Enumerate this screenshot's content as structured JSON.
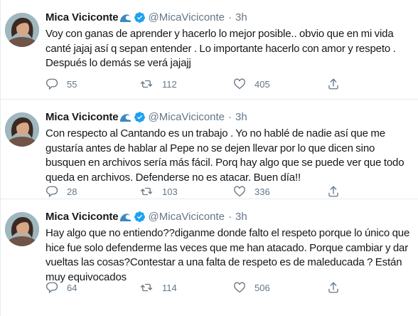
{
  "tweets": [
    {
      "name": "Mica Viciconte",
      "handle": "@MicaViciconte",
      "separator": "·",
      "time": "3h",
      "text": "Voy con ganas de aprender y hacerlo lo mejor posible.. obvio que en mi vida canté jajaj así q sepan entender . Lo importante hacerlo con amor y respeto . Después lo demás se verá jajajj",
      "replies": "55",
      "retweets": "112",
      "likes": "405"
    },
    {
      "name": "Mica Viciconte",
      "handle": "@MicaViciconte",
      "separator": "·",
      "time": "3h",
      "text": "Con respecto al Cantando es un trabajo . Yo no hablé de nadie así que me gustaría antes de hablar al Pepe no se dejen llevar por lo que dicen sino busquen en archivos sería más fácil. Porq hay algo que se puede ver que todo queda en archivos. Defenderse no es atacar. Buen día!!",
      "replies": "28",
      "retweets": "103",
      "likes": "336"
    },
    {
      "name": "Mica Viciconte",
      "handle": "@MicaViciconte",
      "separator": "·",
      "time": "3h",
      "text": "Hay algo que no entiendo??diganme donde falto el respeto porque lo único que hice fue solo defenderme las veces que me han atacado. Porque cambiar y dar vueltas las cosas?Contestar a una falta de respeto es de maleducada ? Están muy equivocados",
      "replies": "64",
      "retweets": "114",
      "likes": "506"
    }
  ],
  "icons": {
    "reply": "reply-icon",
    "retweet": "retweet-icon",
    "like": "like-icon",
    "share": "share-icon",
    "verified": "verified-badge-icon",
    "wave": "wave-emoji-icon"
  },
  "colors": {
    "name": "#14171a",
    "secondary": "#657786",
    "verified": "#1da1f2",
    "wave": "#3b88c3",
    "divider": "#e6ecf0"
  }
}
